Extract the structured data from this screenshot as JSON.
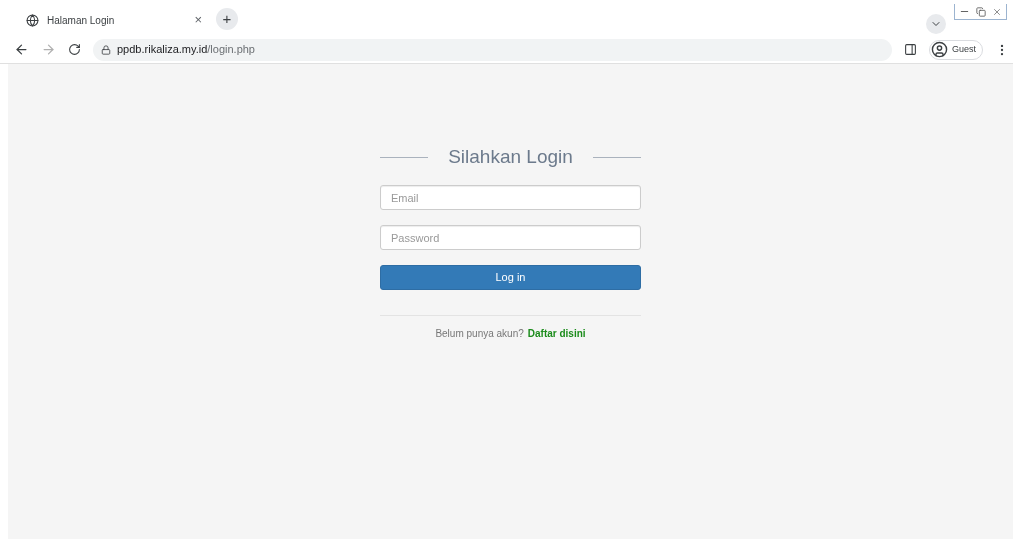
{
  "browser": {
    "tab": {
      "title": "Halaman Login",
      "close": "×",
      "selected": true
    },
    "new_tab": "+",
    "address": {
      "host": "ppdb.rikaliza.my.id",
      "path": "/login.php"
    },
    "profile": "Guest"
  },
  "login": {
    "title": "Silahkan Login",
    "email": {
      "placeholder": "Email"
    },
    "password": {
      "placeholder": "Password"
    },
    "submit": "Log in",
    "prompt": "Belum punya akun?",
    "register_link": "Daftar disini"
  }
}
